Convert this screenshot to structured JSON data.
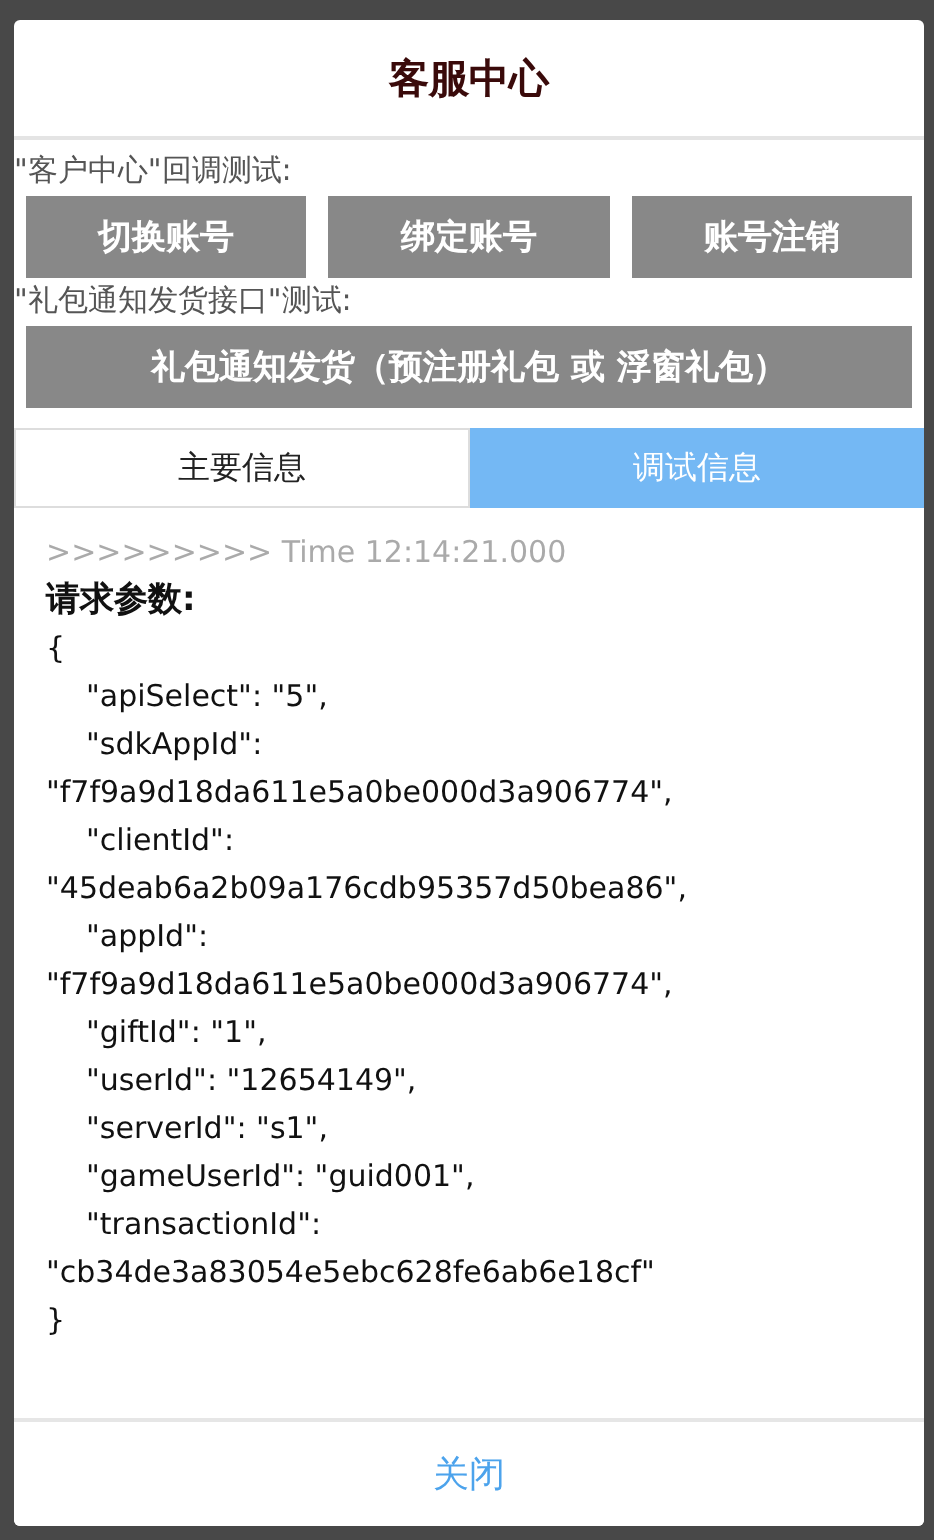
{
  "dialog": {
    "title": "客服中心",
    "sections": [
      {
        "label": "\"客户中心\"回调测试:",
        "buttons": [
          "切换账号",
          "绑定账号",
          "账号注销"
        ]
      },
      {
        "label": "\"礼包通知发货接口\"测试:",
        "buttons": [
          "礼包通知发货（预注册礼包 或 浮窗礼包）"
        ]
      }
    ],
    "tabs": [
      {
        "label": "主要信息",
        "selected": false
      },
      {
        "label": "调试信息",
        "selected": true
      }
    ],
    "log": [
      {
        "kind": "timestamp",
        "text": ">>>>>>>>> Time 12:14:21.000"
      },
      {
        "kind": "heading",
        "text": "请求参数:"
      },
      {
        "kind": "line",
        "indent": false,
        "text": "{"
      },
      {
        "kind": "line",
        "indent": true,
        "text": "\"apiSelect\": \"5\","
      },
      {
        "kind": "line",
        "indent": true,
        "text": "\"sdkAppId\":"
      },
      {
        "kind": "line",
        "indent": false,
        "text": "\"f7f9a9d18da611e5a0be000d3a906774\","
      },
      {
        "kind": "line",
        "indent": true,
        "text": "\"clientId\":"
      },
      {
        "kind": "line",
        "indent": false,
        "text": "\"45deab6a2b09a176cdb95357d50bea86\","
      },
      {
        "kind": "line",
        "indent": true,
        "text": "\"appId\":"
      },
      {
        "kind": "line",
        "indent": false,
        "text": "\"f7f9a9d18da611e5a0be000d3a906774\","
      },
      {
        "kind": "line",
        "indent": true,
        "text": "\"giftId\": \"1\","
      },
      {
        "kind": "line",
        "indent": true,
        "text": "\"userId\": \"12654149\","
      },
      {
        "kind": "line",
        "indent": true,
        "text": "\"serverId\": \"s1\","
      },
      {
        "kind": "line",
        "indent": true,
        "text": "\"gameUserId\": \"guid001\","
      },
      {
        "kind": "line",
        "indent": true,
        "text": "\"transactionId\":"
      },
      {
        "kind": "line",
        "indent": false,
        "text": "\"cb34de3a83054e5ebc628fe6ab6e18cf\""
      },
      {
        "kind": "line",
        "indent": false,
        "text": "}"
      }
    ],
    "close_button": "关闭"
  }
}
